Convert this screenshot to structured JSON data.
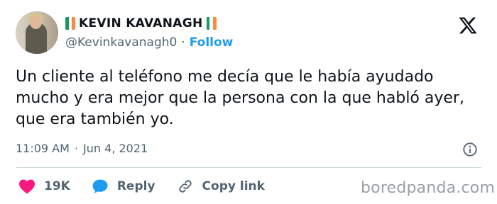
{
  "profile": {
    "display_name": "KEVIN KAVANAGH",
    "handle": "@Kevinkavanagh0",
    "separator": "·",
    "follow_label": "Follow"
  },
  "tweet": {
    "text": "Un cliente al teléfono me decía que le había ayudado mucho y era mejor que la persona con la que habló ayer, que era también yo.",
    "time": "11:09 AM",
    "separator": "·",
    "date": "Jun 4, 2021"
  },
  "actions": {
    "likes": "19K",
    "reply_label": "Reply",
    "copy_link_label": "Copy link"
  },
  "watermark": "boredpanda.com",
  "icons": {
    "brand": "x-logo-icon",
    "like": "heart-icon",
    "reply": "speech-bubble-icon",
    "copy": "link-icon",
    "info": "info-icon",
    "flag": "ireland-flag-icon"
  },
  "colors": {
    "accent": "#1d9bf0",
    "heart": "#f91880",
    "secondary_text": "#536471",
    "flag_green": "#169b62",
    "flag_orange": "#ff883e"
  }
}
